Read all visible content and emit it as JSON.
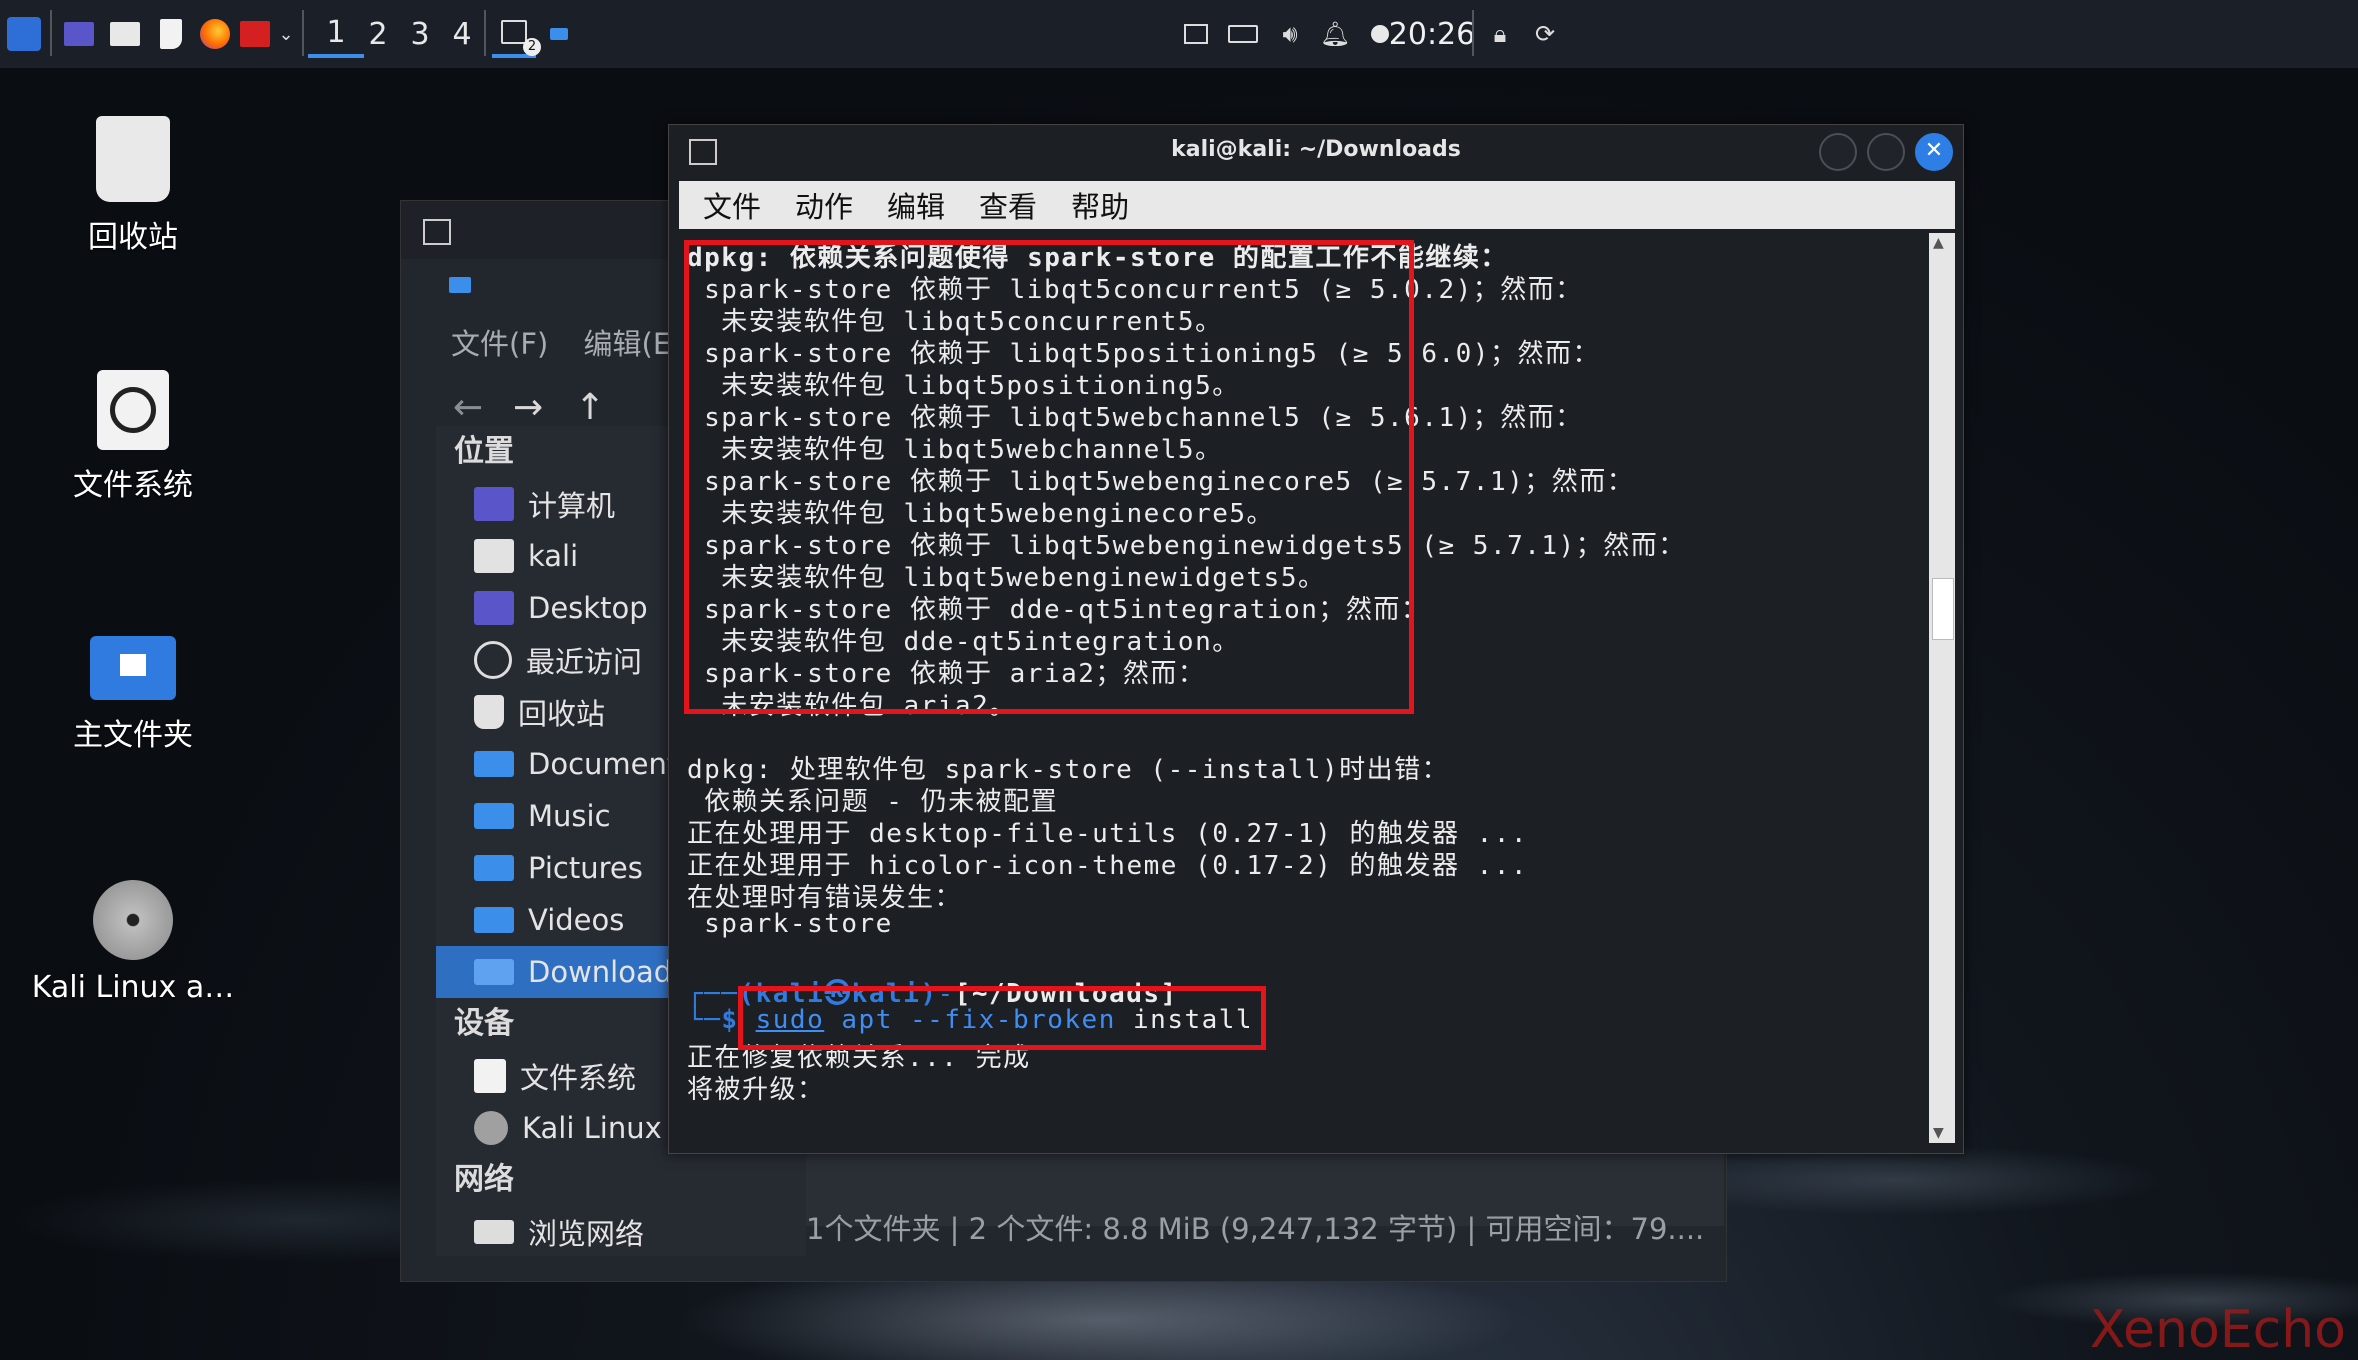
{
  "panel": {
    "workspaces": [
      "1",
      "2",
      "3",
      "4"
    ],
    "terminal_badge": "2",
    "clock": "20:26",
    "icons": [
      "kali-menu-icon",
      "desktop-icon",
      "files-icon",
      "text-editor-icon",
      "firefox-icon",
      "terminal-icon",
      "chevron-down-icon",
      "terminal-task-icon",
      "folder-task-icon",
      "display-icon",
      "keyboard-icon",
      "volume-icon",
      "bell-icon",
      "power-icon",
      "lock-icon",
      "logout-icon"
    ]
  },
  "desktop": {
    "icons": [
      {
        "label": "回收站"
      },
      {
        "label": "文件系统"
      },
      {
        "label": "主文件夹"
      },
      {
        "label": "Kali Linux a…"
      }
    ]
  },
  "file_manager": {
    "menu": [
      "文件(F)",
      "编辑(E"
    ],
    "places_header": "位置",
    "places": [
      "计算机",
      "kali",
      "Desktop",
      "最近访问",
      "回收站",
      "Documents",
      "Music",
      "Pictures",
      "Videos",
      "Downloads"
    ],
    "devices_header": "设备",
    "devices": [
      "文件系统",
      "Kali Linux a…"
    ],
    "network_header": "网络",
    "network": [
      "浏览网络"
    ],
    "status": "1个文件夹 | 2 个文件: 8.8 MiB (9,247,132 字节) | 可用空间：79...."
  },
  "terminal": {
    "title": "kali@kali: ~/Downloads",
    "menu": [
      "文件",
      "动作",
      "编辑",
      "查看",
      "帮助"
    ],
    "lines": [
      "dpkg: 依赖关系问题使得 spark-store 的配置工作不能继续：",
      " spark-store 依赖于 libqt5concurrent5 (≥ 5.0.2)；然而：",
      "  未安装软件包 libqt5concurrent5。",
      " spark-store 依赖于 libqt5positioning5 (≥ 5.6.0)；然而：",
      "  未安装软件包 libqt5positioning5。",
      " spark-store 依赖于 libqt5webchannel5 (≥ 5.6.1)；然而：",
      "  未安装软件包 libqt5webchannel5。",
      " spark-store 依赖于 libqt5webenginecore5 (≥ 5.7.1)；然而：",
      "  未安装软件包 libqt5webenginecore5。",
      " spark-store 依赖于 libqt5webenginewidgets5 (≥ 5.7.1)；然而：",
      "  未安装软件包 libqt5webenginewidgets5。",
      " spark-store 依赖于 dde-qt5integration；然而：",
      "  未安装软件包 dde-qt5integration。",
      " spark-store 依赖于 aria2；然而：",
      "  未安装软件包 aria2。",
      "",
      "dpkg: 处理软件包 spark-store (--install)时出错：",
      " 依赖关系问题 - 仍未被配置",
      "正在处理用于 desktop-file-utils (0.27-1) 的触发器 ...",
      "正在处理用于 hicolor-icon-theme (0.17-2) 的触发器 ...",
      "在处理时有错误发生：",
      " spark-store",
      ""
    ],
    "prompt_user": "(kali㉿kali)",
    "prompt_path": "[~/Downloads]",
    "command_sudo": "sudo",
    "command_rest": "apt --fix-broken",
    "command_install": "install",
    "after": [
      "正在修复依赖关系... 完成",
      "将被升级："
    ]
  },
  "watermark": "XenoEcho"
}
